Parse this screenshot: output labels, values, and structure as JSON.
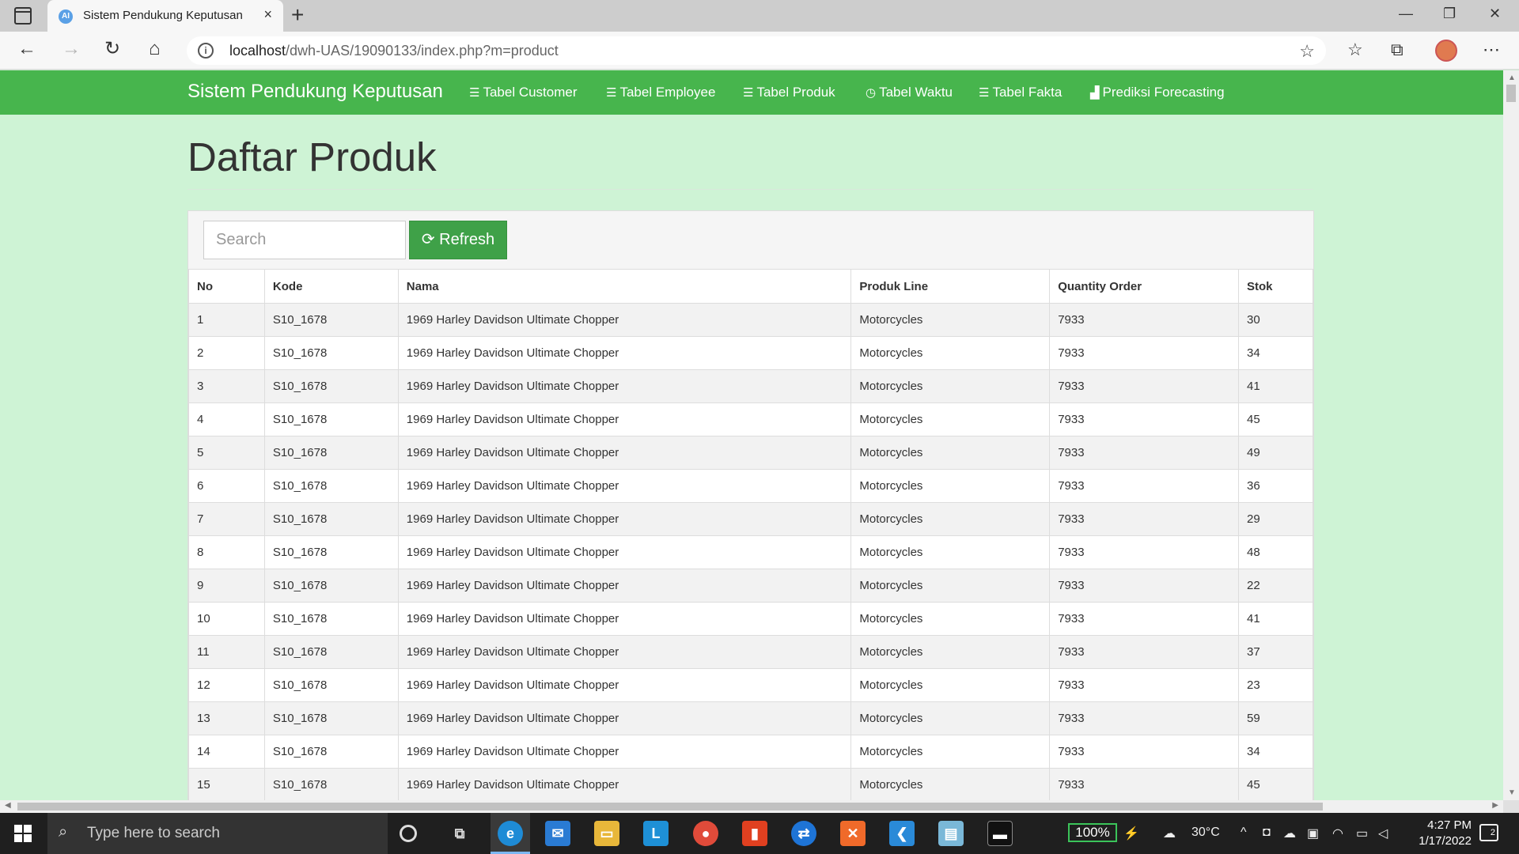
{
  "browser": {
    "tab_favicon": "AI",
    "tab_title": "Sistem Pendukung Keputusan",
    "tab_close": "×",
    "new_tab": "+",
    "url_host": "localhost",
    "url_path": "/dwh-UAS/19090133/index.php?m=product",
    "win_minimize": "—",
    "win_restore": "❐",
    "win_close": "✕"
  },
  "navbar": {
    "brand": "Sistem Pendukung Keputusan",
    "items": [
      {
        "icon": "table-icon",
        "glyph": "☰",
        "label": "Tabel Customer"
      },
      {
        "icon": "table-icon",
        "glyph": "☰",
        "label": "Tabel Employee"
      },
      {
        "icon": "table-icon",
        "glyph": "☰",
        "label": "Tabel Produk"
      },
      {
        "icon": "clock-icon",
        "glyph": "◷",
        "label": "Tabel Waktu"
      },
      {
        "icon": "table-icon",
        "glyph": "☰",
        "label": "Tabel Fakta"
      },
      {
        "icon": "bar-chart-icon",
        "glyph": "▟",
        "label": "Prediksi Forecasting"
      }
    ]
  },
  "page": {
    "title": "Daftar Produk",
    "search_placeholder": "Search",
    "refresh_label": "Refresh"
  },
  "table": {
    "headers": [
      "No",
      "Kode",
      "Nama",
      "Produk Line",
      "Quantity Order",
      "Stok"
    ],
    "rows": [
      [
        "1",
        "S10_1678",
        "1969 Harley Davidson Ultimate Chopper",
        "Motorcycles",
        "7933",
        "30"
      ],
      [
        "2",
        "S10_1678",
        "1969 Harley Davidson Ultimate Chopper",
        "Motorcycles",
        "7933",
        "34"
      ],
      [
        "3",
        "S10_1678",
        "1969 Harley Davidson Ultimate Chopper",
        "Motorcycles",
        "7933",
        "41"
      ],
      [
        "4",
        "S10_1678",
        "1969 Harley Davidson Ultimate Chopper",
        "Motorcycles",
        "7933",
        "45"
      ],
      [
        "5",
        "S10_1678",
        "1969 Harley Davidson Ultimate Chopper",
        "Motorcycles",
        "7933",
        "49"
      ],
      [
        "6",
        "S10_1678",
        "1969 Harley Davidson Ultimate Chopper",
        "Motorcycles",
        "7933",
        "36"
      ],
      [
        "7",
        "S10_1678",
        "1969 Harley Davidson Ultimate Chopper",
        "Motorcycles",
        "7933",
        "29"
      ],
      [
        "8",
        "S10_1678",
        "1969 Harley Davidson Ultimate Chopper",
        "Motorcycles",
        "7933",
        "48"
      ],
      [
        "9",
        "S10_1678",
        "1969 Harley Davidson Ultimate Chopper",
        "Motorcycles",
        "7933",
        "22"
      ],
      [
        "10",
        "S10_1678",
        "1969 Harley Davidson Ultimate Chopper",
        "Motorcycles",
        "7933",
        "41"
      ],
      [
        "11",
        "S10_1678",
        "1969 Harley Davidson Ultimate Chopper",
        "Motorcycles",
        "7933",
        "37"
      ],
      [
        "12",
        "S10_1678",
        "1969 Harley Davidson Ultimate Chopper",
        "Motorcycles",
        "7933",
        "23"
      ],
      [
        "13",
        "S10_1678",
        "1969 Harley Davidson Ultimate Chopper",
        "Motorcycles",
        "7933",
        "59"
      ],
      [
        "14",
        "S10_1678",
        "1969 Harley Davidson Ultimate Chopper",
        "Motorcycles",
        "7933",
        "34"
      ],
      [
        "15",
        "S10_1678",
        "1969 Harley Davidson Ultimate Chopper",
        "Motorcycles",
        "7933",
        "45"
      ]
    ]
  },
  "taskbar": {
    "search_placeholder": "Type here to search",
    "battery": "100%",
    "weather": "30°C",
    "time": "4:27 PM",
    "date": "1/17/2022",
    "notifications": "2"
  },
  "colors": {
    "navbar": "#47b54d",
    "page_bg": "#cef3d5",
    "refresh_button": "#3fa148"
  }
}
